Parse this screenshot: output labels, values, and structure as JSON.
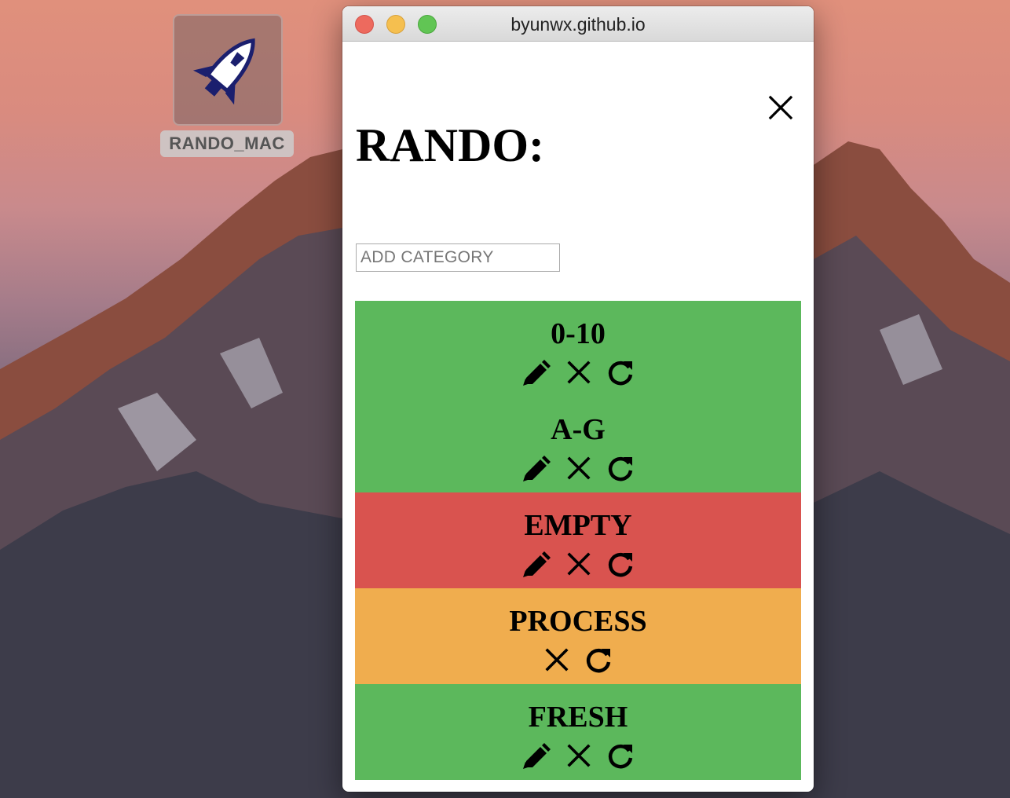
{
  "desktop": {
    "icon_label": "RANDO_MAC"
  },
  "window": {
    "title": "byunwx.github.io"
  },
  "app": {
    "heading": "RANDO:",
    "add_category_placeholder": "ADD CATEGORY",
    "categories": [
      {
        "name": "0-10",
        "status_color": "#5cb85c",
        "actions": [
          "pencil-icon",
          "close-icon",
          "refresh-icon"
        ]
      },
      {
        "name": "A-G",
        "status_color": "#5cb85c",
        "actions": [
          "pencil-icon",
          "close-icon",
          "refresh-icon"
        ]
      },
      {
        "name": "EMPTY",
        "status_color": "#d9534f",
        "actions": [
          "pencil-icon",
          "close-icon",
          "refresh-icon"
        ]
      },
      {
        "name": "PROCESS",
        "status_color": "#f0ad4e",
        "actions": [
          "close-icon",
          "refresh-icon"
        ]
      },
      {
        "name": "FRESH",
        "status_color": "#5cb85c",
        "actions": [
          "pencil-icon",
          "close-icon",
          "refresh-icon"
        ]
      }
    ]
  }
}
